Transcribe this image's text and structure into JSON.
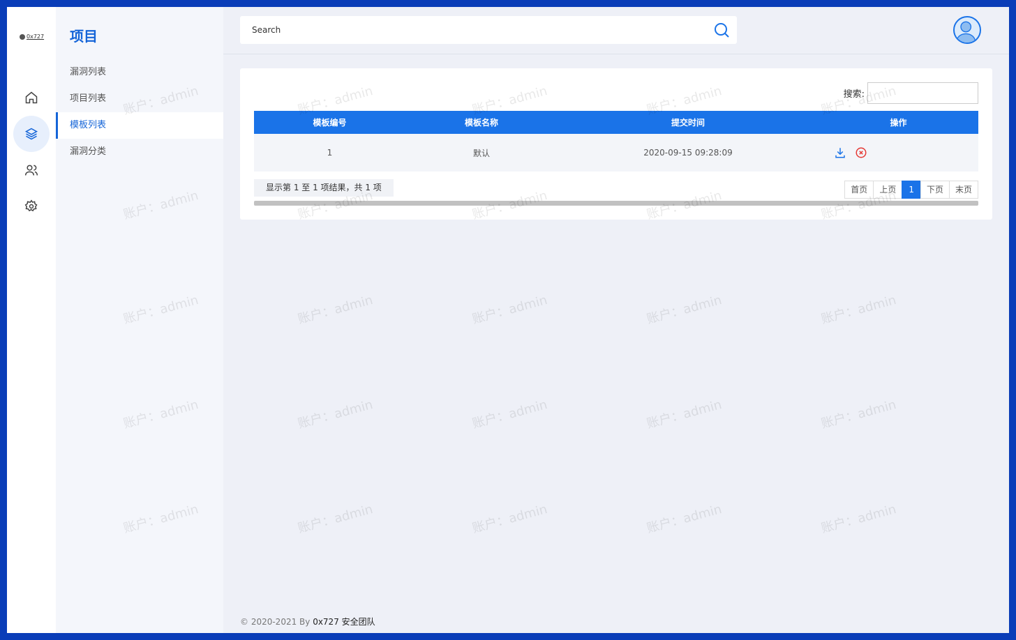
{
  "logo": {
    "text": "0x727"
  },
  "rail": {
    "items": [
      "home-icon",
      "layers-icon",
      "users-icon",
      "gear-icon"
    ],
    "active": "layers-icon"
  },
  "subnav": {
    "title": "项目",
    "items": [
      {
        "label": "漏洞列表"
      },
      {
        "label": "项目列表"
      },
      {
        "label": "模板列表",
        "active": true
      },
      {
        "label": "漏洞分类"
      }
    ]
  },
  "header": {
    "search_placeholder": "Search"
  },
  "filter": {
    "label": "搜索:"
  },
  "table": {
    "columns": [
      "模板编号",
      "模板名称",
      "提交时间",
      "操作"
    ],
    "rows": [
      {
        "id": "1",
        "name": "默认",
        "time": "2020-09-15 09:28:09"
      }
    ]
  },
  "pagination": {
    "info": "显示第 1 至 1 项结果，共 1 项",
    "first": "首页",
    "prev": "上页",
    "current": "1",
    "next": "下页",
    "last": "末页"
  },
  "footer": {
    "copyright": "© 2020-2021 By ",
    "brand": "0x727 安全团队"
  },
  "watermark": "账户：admin",
  "colors": {
    "accent": "#1a73e8",
    "frame": "#0a3db8",
    "danger": "#e53935"
  }
}
